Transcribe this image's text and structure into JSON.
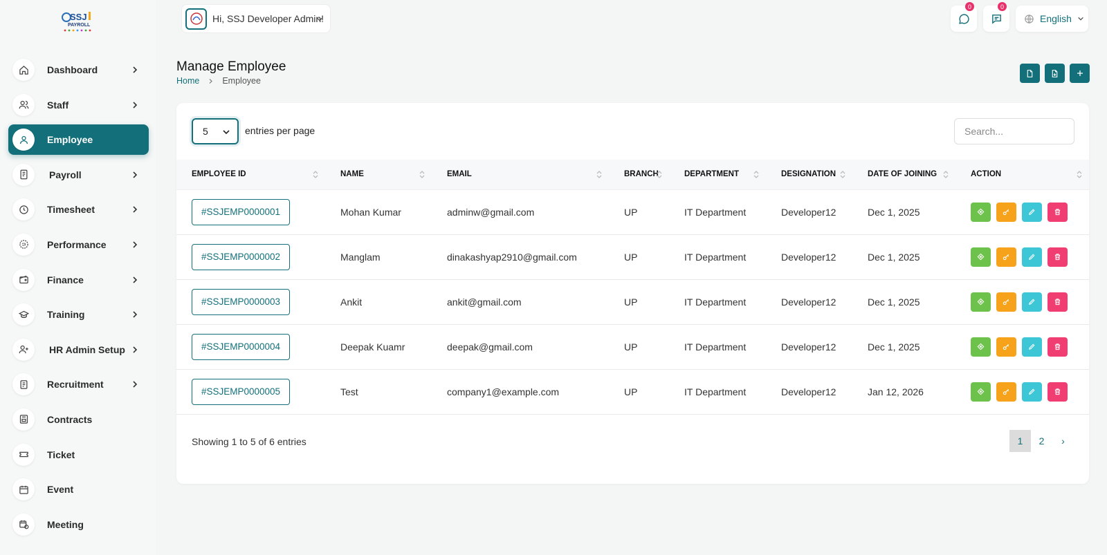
{
  "app": {
    "logo_alt": "SSJ PAYROLL"
  },
  "sidebar": {
    "items": [
      {
        "label": "Dashboard",
        "icon": "home-icon",
        "chevron": true
      },
      {
        "label": "Staff",
        "icon": "users-icon",
        "chevron": true
      },
      {
        "label": "Employee",
        "icon": "user-icon",
        "chevron": false,
        "active": true
      },
      {
        "label": "Payroll",
        "icon": "receipt-icon",
        "chevron": true
      },
      {
        "label": "Timesheet",
        "icon": "clock-icon",
        "chevron": true
      },
      {
        "label": "Performance",
        "icon": "target-icon",
        "chevron": true
      },
      {
        "label": "Finance",
        "icon": "wallet-icon",
        "chevron": true
      },
      {
        "label": "Training",
        "icon": "graduation-cap-icon",
        "chevron": true
      },
      {
        "label": "HR Admin Setup",
        "icon": "user-plus-icon",
        "chevron": true
      },
      {
        "label": "Recruitment",
        "icon": "clipboard-icon",
        "chevron": true
      },
      {
        "label": "Contracts",
        "icon": "contract-icon",
        "chevron": false
      },
      {
        "label": "Ticket",
        "icon": "ticket-icon",
        "chevron": false
      },
      {
        "label": "Event",
        "icon": "calendar-icon",
        "chevron": false
      },
      {
        "label": "Meeting",
        "icon": "calendar-clock-icon",
        "chevron": false
      }
    ]
  },
  "topbar": {
    "greeting": "Hi, SSJ Developer Admin!",
    "messages_count": "0",
    "notifications_count": "0",
    "language": "English"
  },
  "header": {
    "title": "Manage Employee",
    "breadcrumb_home": "Home",
    "breadcrumb_current": "Employee"
  },
  "table_controls": {
    "per_page": "5",
    "per_page_label": "entries per page",
    "search_placeholder": "Search..."
  },
  "table": {
    "columns": [
      "EMPLOYEE ID",
      "NAME",
      "EMAIL",
      "BRANCH",
      "DEPARTMENT",
      "DESIGNATION",
      "DATE OF JOINING",
      "ACTION"
    ],
    "rows": [
      {
        "id": "#SSJEMP0000001",
        "name": "Mohan Kumar",
        "email": "adminw@gmail.com",
        "branch": "UP",
        "department": "IT Department",
        "designation": "Developer12",
        "date": "Dec 1, 2025"
      },
      {
        "id": "#SSJEMP0000002",
        "name": "Manglam",
        "email": "dinakashyap2910@gmail.com",
        "branch": "UP",
        "department": "IT Department",
        "designation": "Developer12",
        "date": "Dec 1, 2025"
      },
      {
        "id": "#SSJEMP0000003",
        "name": "Ankit",
        "email": "ankit@gmail.com",
        "branch": "UP",
        "department": "IT Department",
        "designation": "Developer12",
        "date": "Dec 1, 2025"
      },
      {
        "id": "#SSJEMP0000004",
        "name": "Deepak Kuamr",
        "email": "deepak@gmail.com",
        "branch": "UP",
        "department": "IT Department",
        "designation": "Developer12",
        "date": "Dec 1, 2025"
      },
      {
        "id": "#SSJEMP0000005",
        "name": "Test",
        "email": "company1@example.com",
        "branch": "UP",
        "department": "IT Department",
        "designation": "Developer12",
        "date": "Jan 12, 2026"
      }
    ]
  },
  "footer": {
    "info": "Showing 1 to 5 of 6 entries",
    "pages": [
      "1",
      "2"
    ],
    "next": "›"
  },
  "colors": {
    "primary": "#13707a",
    "green": "#6cc24a",
    "orange": "#f7a21b",
    "cyan": "#3dc6d6",
    "pink": "#f03e72"
  }
}
